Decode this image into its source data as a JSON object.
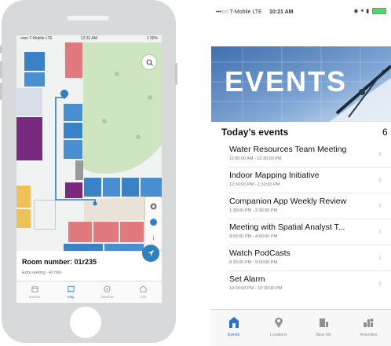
{
  "left_phone": {
    "status_bar": {
      "carrier": "•ooo T-Mobile LTE",
      "time": "12:31 AM",
      "battery": "1 30%"
    },
    "room_title": "Room number: 01r235",
    "room_subtitle": "Extra walking · 42 mile",
    "info_button": "i",
    "tabs": [
      {
        "label": "Events",
        "icon": "calendar-icon"
      },
      {
        "label": "Map",
        "icon": "map-icon"
      },
      {
        "label": "Nearme",
        "icon": "compass-icon"
      },
      {
        "label": "Info",
        "icon": "building-icon"
      }
    ],
    "active_tab": 1,
    "colors": {
      "accent": "#2f7fc1",
      "red_room": "#e07a7e",
      "purple_room": "#7a2a7e",
      "blue_room": "#3a82c8",
      "yellow_room": "#eec05a",
      "green_area": "#cfe5c2"
    }
  },
  "events_app": {
    "status_bar": {
      "carrier": "•••○○ T-Mobile LTE",
      "time": "10:21 AM",
      "battery": "◉ ✶ ▮"
    },
    "banner_text": "EVENTS",
    "section_title": "Today's events",
    "section_count": "6",
    "events": [
      {
        "title": "Water Resources Team Meeting",
        "time": "11:00:00 AM - 12:30:00 PM"
      },
      {
        "title": "Indoor Mapping Initiative",
        "time": "12:30:00 PM - 1:30:00 PM"
      },
      {
        "title": "Companion App Weekly Review",
        "time": "1:30:00 PM - 2:30:00 PM"
      },
      {
        "title": "Meeting with Spatial Analyst T...",
        "time": "3:00:00 PM - 4:00:00 PM"
      },
      {
        "title": "Watch PodCasts",
        "time": "8:30:00 PM - 9:00:00 PM"
      },
      {
        "title": "Set Alarm",
        "time": "10:00:00 PM - 10:30:00 PM"
      }
    ],
    "tabs": [
      {
        "label": "Events",
        "icon": "building-icon"
      },
      {
        "label": "Locations",
        "icon": "map-pin-icon"
      },
      {
        "label": "Near Me",
        "icon": "nearby-icon"
      },
      {
        "label": "Amenities",
        "icon": "amenities-icon"
      }
    ],
    "active_tab": 0,
    "colors": {
      "accent": "#2a73c8",
      "banner": "#5d85b8"
    }
  }
}
